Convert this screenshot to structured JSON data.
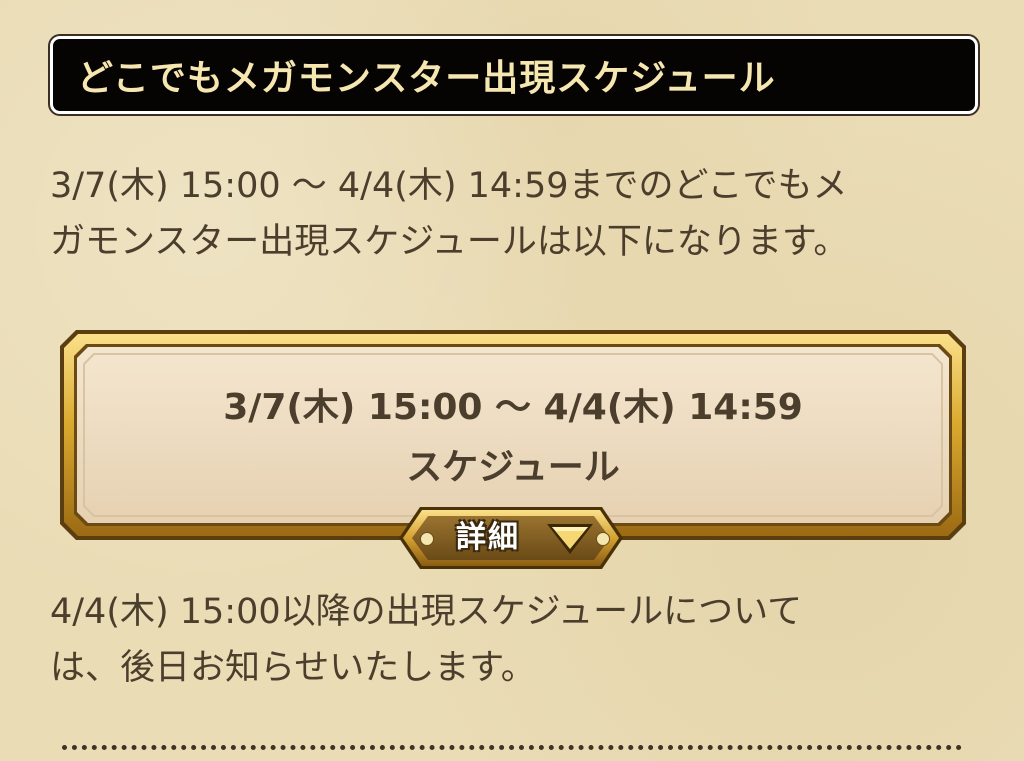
{
  "header": {
    "title": "どこでもメガモンスター出現スケジュール"
  },
  "intro": {
    "line1": "3/7(木) 15:00 〜 4/4(木) 14:59までのどこでもメ",
    "line2": "ガモンスター出現スケジュールは以下になります。"
  },
  "schedule_panel": {
    "period": "3/7(木) 15:00 〜 4/4(木) 14:59",
    "label": "スケジュール",
    "detail_button": "詳細",
    "detail_icon": "triangle-down-icon"
  },
  "notice": {
    "line1": "4/4(木) 15:00以降の出現スケジュールについて",
    "line2": "は、後日お知らせいたします。"
  },
  "colors": {
    "background": "#eadcb5",
    "header_bg": "#050403",
    "header_text": "#f6e7b0",
    "body_text": "#4b3e2d",
    "gold_frame": "#d4a52c",
    "panel_fill": "#ecd9bd"
  }
}
